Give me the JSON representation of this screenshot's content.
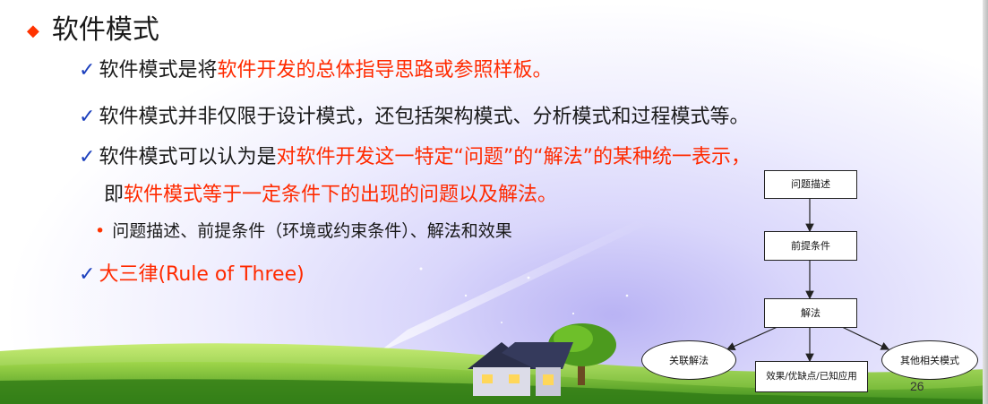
{
  "heading": "软件模式",
  "bullets": [
    {
      "plain": "软件模式是将",
      "highlight": "软件开发的总体指导思路或参照样板。"
    },
    {
      "plain": "软件模式并非仅限于设计模式，还包括架构模式、分析模式和过程模式等。"
    },
    {
      "plain": "软件模式可以认为是",
      "highlight": "对软件开发这一特定“问题”的“解法”的某种统一表示，",
      "line2_plain": "即",
      "line2_highlight": "软件模式等于一定条件下的出现的问题以及解法。"
    },
    {
      "sub": "问题描述、前提条件（环境或约束条件）、解法和效果"
    },
    {
      "highlight": "大三律(Rule of Three)"
    }
  ],
  "flowchart": {
    "problem": "问题描述",
    "precondition": "前提条件",
    "solution": "解法",
    "related_left": "关联解法",
    "effect": "效果/优缺点/已知应用",
    "related_right": "其他相关模式"
  },
  "page_number": "26",
  "colors": {
    "highlight": "#ff2a00",
    "check": "#1b3fbd",
    "grass": "#6fba2c"
  }
}
